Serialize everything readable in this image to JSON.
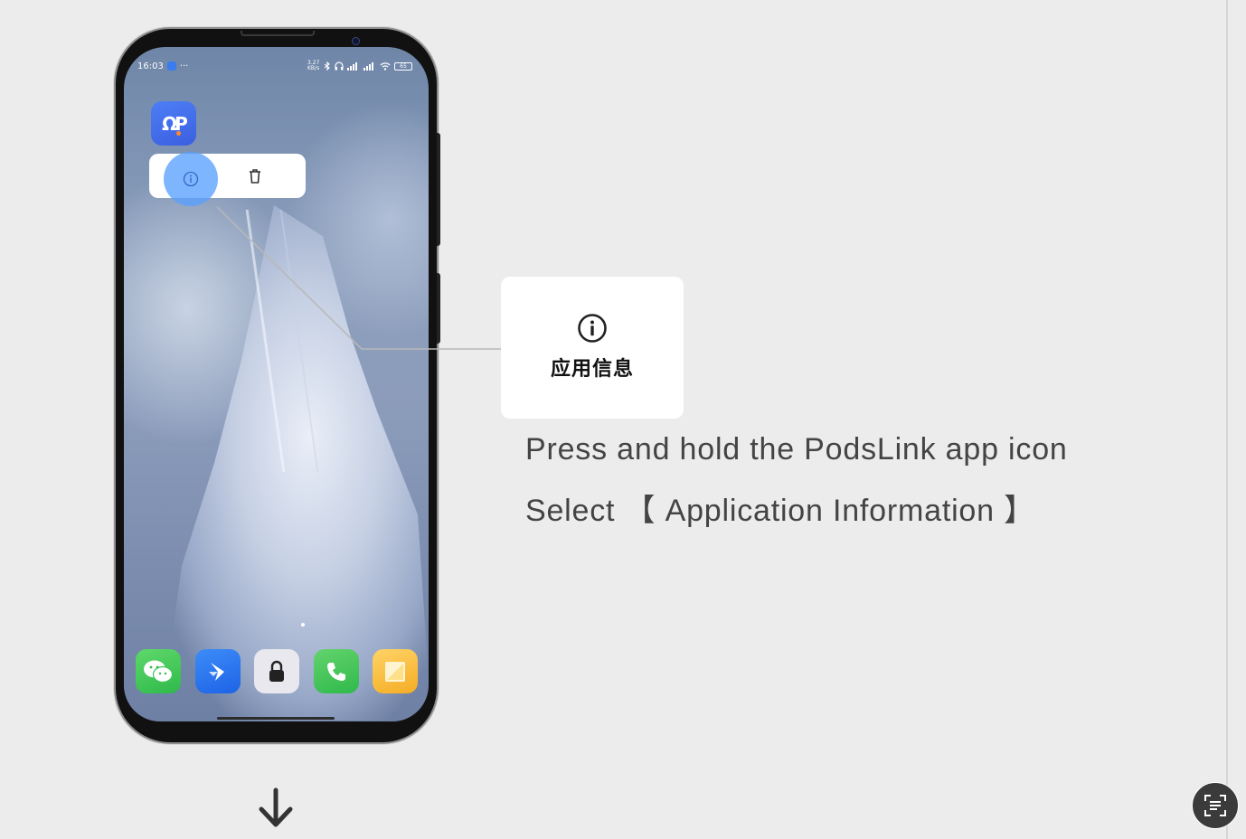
{
  "status_bar": {
    "time": "16:03",
    "indicators": "···",
    "net_speed": "3.27 KB/s",
    "battery": "65"
  },
  "home_screen": {
    "app_icon": {
      "name": "PodsLink",
      "glyph": "ΩΡ",
      "icon": "podslink-app-icon"
    },
    "popup_actions": [
      {
        "icon": "info-icon",
        "label": "App info"
      },
      {
        "icon": "trash-icon",
        "label": "Uninstall"
      }
    ],
    "dock_apps": [
      {
        "icon": "wechat-icon"
      },
      {
        "icon": "feishu-icon"
      },
      {
        "icon": "lock-icon"
      },
      {
        "icon": "phone-icon"
      },
      {
        "icon": "notes-icon"
      }
    ]
  },
  "callout": {
    "icon": "info-icon",
    "label": "应用信息"
  },
  "instructions": {
    "line1": "Press and hold the PodsLink app icon",
    "line2": "Select 【 Application Information 】"
  },
  "colors": {
    "background": "#ececec",
    "tap_highlight": "#5aa0ff",
    "app_icon": "#4468ec",
    "instruction_text": "#444444"
  }
}
